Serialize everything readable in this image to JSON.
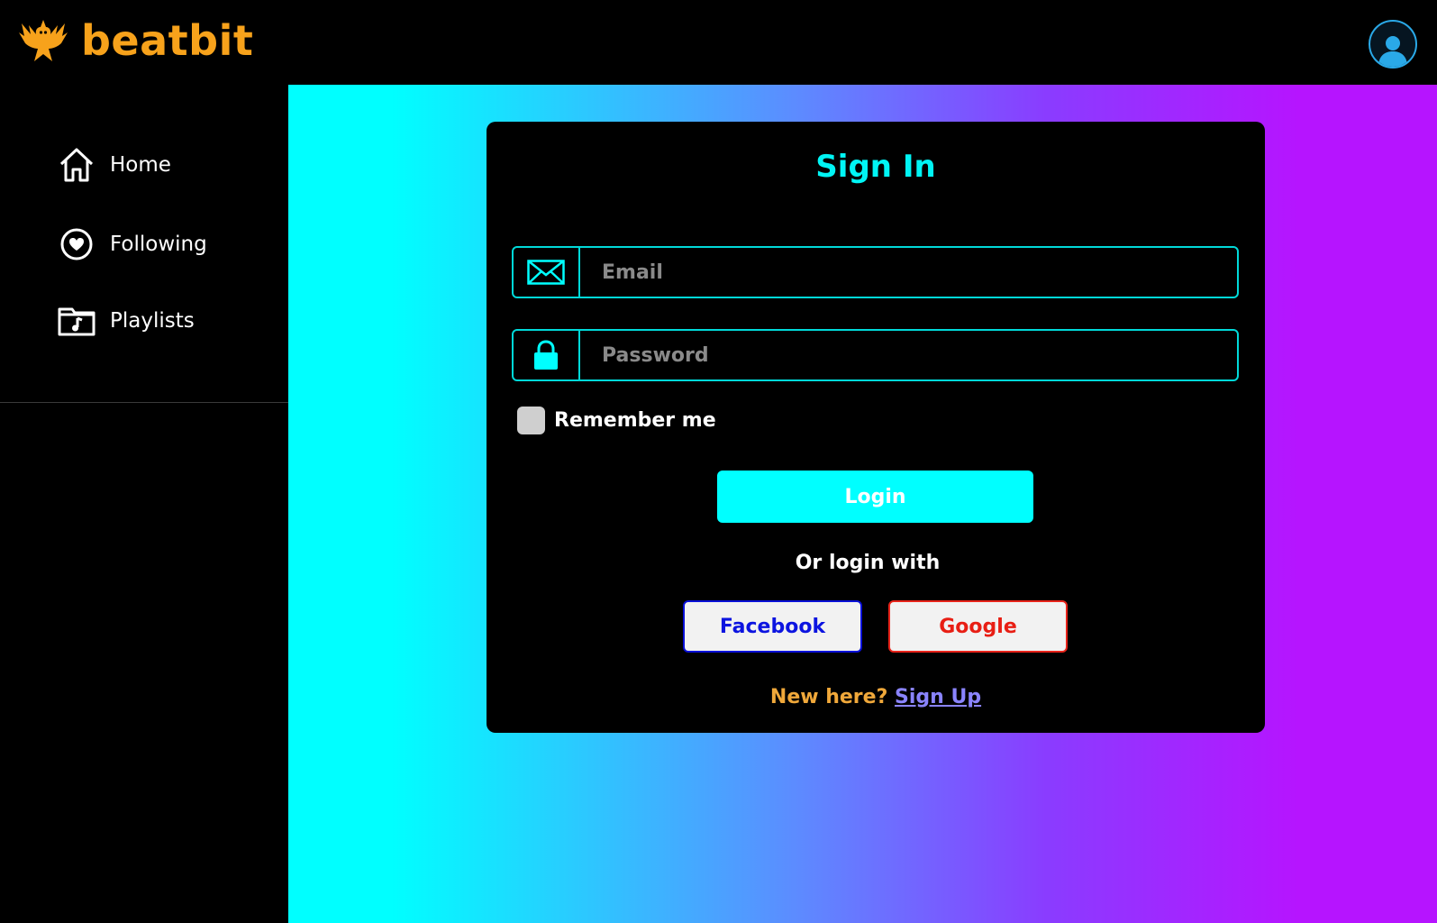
{
  "app": {
    "brand_name": "beatbit",
    "brand_color": "#f7a21b",
    "logo_icon": "phoenix-logo-icon"
  },
  "header": {
    "profile_icon": "user-avatar-icon"
  },
  "sidebar": {
    "items": [
      {
        "label": "Home",
        "icon": "home-icon"
      },
      {
        "label": "Following",
        "icon": "heart-circle-icon"
      },
      {
        "label": "Playlists",
        "icon": "music-folder-icon"
      }
    ]
  },
  "signin": {
    "title": "Sign In",
    "email": {
      "placeholder": "Email",
      "value": "",
      "icon": "envelope-icon"
    },
    "password": {
      "placeholder": "Password",
      "value": "",
      "icon": "lock-icon"
    },
    "remember_label": "Remember me",
    "remember_checked": false,
    "login_label": "Login",
    "or_text": "Or login with",
    "facebook_label": "Facebook",
    "google_label": "Google",
    "new_here_text": "New here?",
    "signup_label": "Sign Up"
  },
  "colors": {
    "accent": "#00ffff",
    "gradient_start": "#00ffff",
    "gradient_end": "#b614ff",
    "facebook": "#0c14e0",
    "google": "#e81e14",
    "signup_link": "#8a84ff",
    "new_here": "#f0a83a"
  }
}
